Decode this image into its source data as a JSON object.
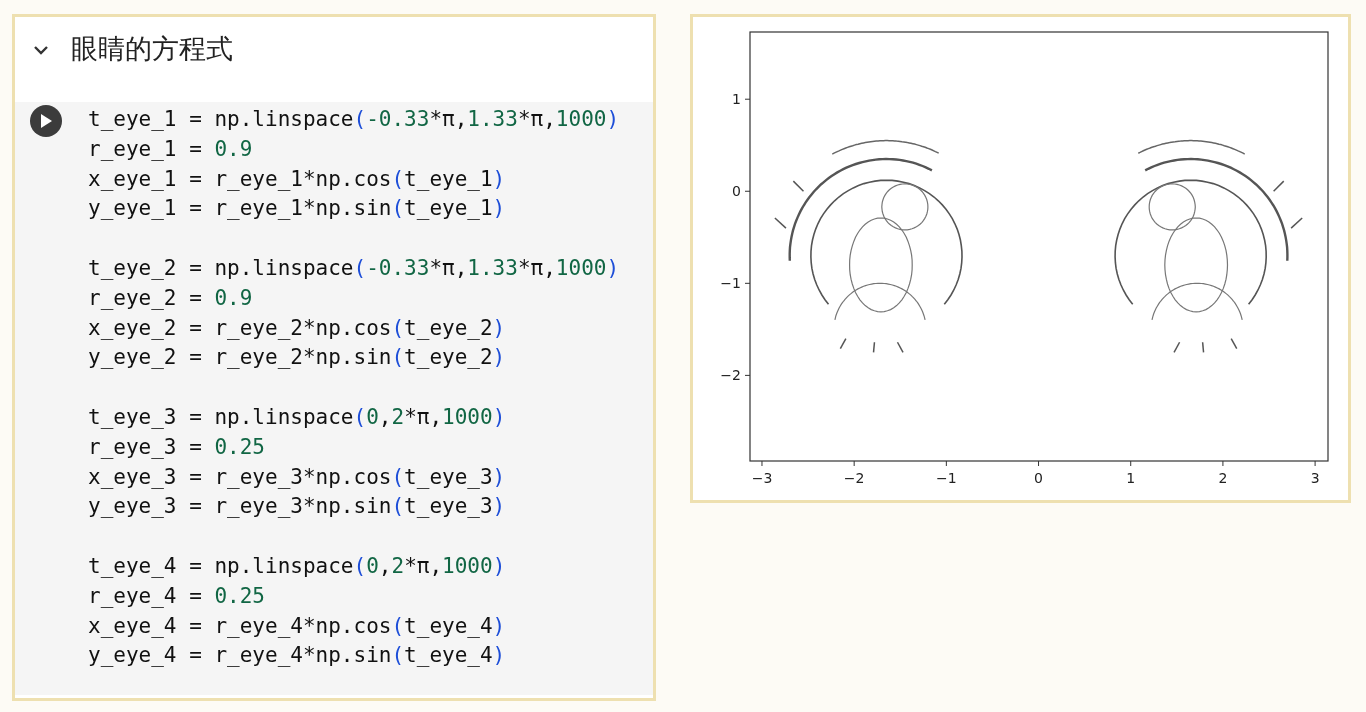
{
  "section": {
    "title": "眼睛的方程式",
    "expanded": true
  },
  "code_blocks": [
    [
      "t_eye_1 = np.linspace(-0.33*π,1.33*π,1000)",
      "r_eye_1 = 0.9",
      "x_eye_1 = r_eye_1*np.cos(t_eye_1)",
      "y_eye_1 = r_eye_1*np.sin(t_eye_1)"
    ],
    [
      "t_eye_2 = np.linspace(-0.33*π,1.33*π,1000)",
      "r_eye_2 = 0.9",
      "x_eye_2 = r_eye_2*np.cos(t_eye_2)",
      "y_eye_2 = r_eye_2*np.sin(t_eye_2)"
    ],
    [
      "t_eye_3 = np.linspace(0,2*π,1000)",
      "r_eye_3 = 0.25",
      "x_eye_3 = r_eye_3*np.cos(t_eye_3)",
      "y_eye_3 = r_eye_3*np.sin(t_eye_3)"
    ],
    [
      "t_eye_4 = np.linspace(0,2*π,1000)",
      "r_eye_4 = 0.25",
      "x_eye_4 = r_eye_4*np.cos(t_eye_4)",
      "y_eye_4 = r_eye_4*np.sin(t_eye_4)"
    ]
  ],
  "output": {
    "chart_data": {
      "type": "line",
      "xlim": [
        -3.13,
        3.14
      ],
      "ylim": [
        -2.93,
        1.73
      ],
      "xticks": [
        {
          "value": -3,
          "label": "−3"
        },
        {
          "value": -2,
          "label": "−2"
        },
        {
          "value": -1,
          "label": "−1"
        },
        {
          "value": 0,
          "label": "0"
        },
        {
          "value": 1,
          "label": "1"
        },
        {
          "value": 2,
          "label": "2"
        },
        {
          "value": 3,
          "label": "3"
        }
      ],
      "yticks": [
        {
          "value": 1,
          "label": "1"
        },
        {
          "value": 0,
          "label": "0"
        },
        {
          "value": -1,
          "label": "−1"
        },
        {
          "value": -2,
          "label": "−2"
        }
      ]
    }
  }
}
